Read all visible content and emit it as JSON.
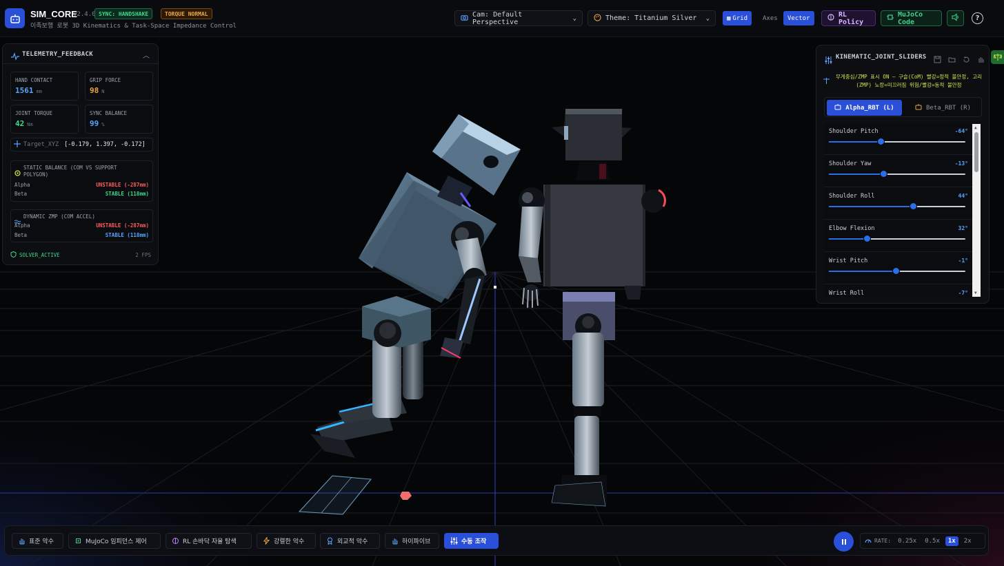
{
  "app": {
    "title": "SIM_CORE",
    "version": "v2.4.0",
    "subtitle": "이족보행 로봇 3D Kinematics & Task-Space Impedance Control",
    "badge_sync": "SYNC: HANDSHAKE",
    "badge_torque": "TORQUE NORMAL"
  },
  "header": {
    "camera": "Cam: Default Perspective",
    "theme": "Theme: Titanium Silver",
    "grid": "Grid",
    "axes": "Axes",
    "vector": "Vector",
    "rl_policy": "RL Policy",
    "mujoco_code": "MuJoCo Code",
    "help": "?"
  },
  "telemetry": {
    "title": "TELEMETRY_FEEDBACK",
    "metrics": [
      {
        "label": "HAND CONTACT",
        "value": "1561",
        "unit": "mm",
        "color": "#58a6ff"
      },
      {
        "label": "GRIP FORCE",
        "value": "98",
        "unit": "N",
        "color": "#f0a640"
      },
      {
        "label": "JOINT TORQUE",
        "value": "42",
        "unit": "Nm",
        "color": "#3fd98b"
      },
      {
        "label": "SYNC BALANCE",
        "value": "99",
        "unit": "%",
        "color": "#58a6ff"
      }
    ],
    "target_label": "Target_XYZ",
    "target_value": "[-0.179, 1.397, -0.172]",
    "static_balance": {
      "title": "STATIC BALANCE (COM VS SUPPORT POLYGON)",
      "alpha_label": "Alpha",
      "alpha_value": "UNSTABLE (-287mm)",
      "beta_label": "Beta",
      "beta_value": "STABLE (118mm)"
    },
    "dynamic_zmp": {
      "title": "DYNAMIC ZMP (COM ACCEL)",
      "alpha_label": "Alpha",
      "alpha_value": "UNSTABLE (-287mm)",
      "beta_label": "Beta",
      "beta_value": "STABLE (118mm)"
    },
    "solver": "SOLVER_ACTIVE",
    "fps": "2 FPS"
  },
  "kinematic": {
    "title": "KINEMATIC_JOINT_SLIDERS",
    "note": "무게중심/ZMP 표시 ON — 구슬(CoM) 빨강=정적 불안정, 고리(ZMP) 노랑=미끄러짐 위험/빨강=동적 불안정",
    "tab_alpha": "Alpha_RBT (L)",
    "tab_beta": "Beta_RBT (R)",
    "sliders": [
      {
        "label": "Shoulder Pitch",
        "value": "-64°",
        "fraction": 0.38
      },
      {
        "label": "Shoulder Yaw",
        "value": "-13°",
        "fraction": 0.4
      },
      {
        "label": "Shoulder Roll",
        "value": "44°",
        "fraction": 0.62
      },
      {
        "label": "Elbow Flexion",
        "value": "32°",
        "fraction": 0.28
      },
      {
        "label": "Wrist Pitch",
        "value": "-1°",
        "fraction": 0.49
      },
      {
        "label": "Wrist Roll",
        "value": "-7°",
        "fraction": 0.47
      }
    ]
  },
  "bottom": {
    "modes": [
      {
        "label": "표준 악수",
        "icon": "hand-icon",
        "active": false
      },
      {
        "label": "MuJoCo 임피던스 제어",
        "icon": "cpu-icon",
        "active": false
      },
      {
        "label": "RL 손바닥 자율 탐색",
        "icon": "brain-icon",
        "active": false
      },
      {
        "label": "강렬한 악수",
        "icon": "lightning-icon",
        "active": false
      },
      {
        "label": "외교적 악수",
        "icon": "award-icon",
        "active": false
      },
      {
        "label": "하이파이브",
        "icon": "hand-icon",
        "active": false
      },
      {
        "label": "수동 조작",
        "icon": "sliders-icon",
        "active": true
      }
    ],
    "rate_label": "RATE:",
    "rates": [
      {
        "label": "0.25x",
        "active": false
      },
      {
        "label": "0.5x",
        "active": false
      },
      {
        "label": "1x",
        "active": true
      },
      {
        "label": "2x",
        "active": false
      }
    ]
  },
  "colors": {
    "accent": "#2a4fd8",
    "success": "#3fd98b",
    "danger": "#ff5c5c",
    "warning": "#f0a640",
    "info": "#58a6ff"
  }
}
